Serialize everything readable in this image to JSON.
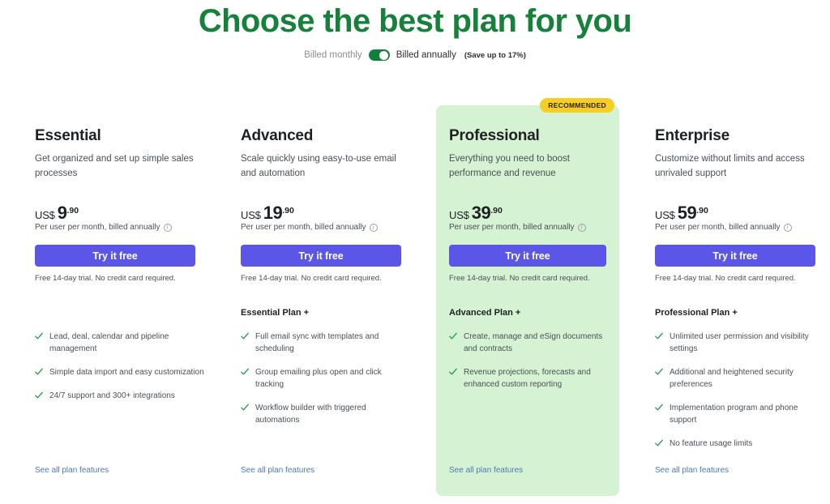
{
  "header": {
    "title": "Choose the best plan for you",
    "title_color": "#17813c",
    "billing": {
      "monthly_label": "Billed monthly",
      "annually_label": "Billed annually",
      "save_note": "(Save up to 17%)",
      "toggle_state": "annually",
      "toggle_on_color": "#12803c"
    }
  },
  "accent": {
    "button": "#5b55e8",
    "featured_bg": "#d5f2d2",
    "badge_bg": "#f6cf21",
    "check": "#1f9d4d",
    "link": "#4d7bb5"
  },
  "common": {
    "price_currency": "US$",
    "price_cents": ".90",
    "price_sub": "Per user per month, billed annually",
    "cta_label": "Try it free",
    "trial_note": "Free 14-day trial. No credit card required.",
    "see_all_label": "See all plan features",
    "info_icon": "info-icon"
  },
  "plans": [
    {
      "name": "Essential",
      "description": "Get organized and set up simple sales processes",
      "price_amount": "9",
      "recommended": false,
      "badge_label": "",
      "includes_header": "",
      "features": [
        "Lead, deal, calendar and pipeline management",
        "Simple data import and easy customization",
        "24/7 support and 300+ integrations"
      ]
    },
    {
      "name": "Advanced",
      "description": "Scale quickly using easy-to-use email and automation",
      "price_amount": "19",
      "recommended": false,
      "badge_label": "",
      "includes_header": "Essential Plan +",
      "features": [
        "Full email sync with templates and scheduling",
        "Group emailing plus open and click tracking",
        "Workflow builder with triggered automations"
      ]
    },
    {
      "name": "Professional",
      "description": "Everything you need to boost performance and revenue",
      "price_amount": "39",
      "recommended": true,
      "badge_label": "RECOMMENDED",
      "includes_header": "Advanced Plan +",
      "features": [
        "Create, manage and eSign documents and contracts",
        "Revenue projections, forecasts and enhanced custom reporting"
      ]
    },
    {
      "name": "Enterprise",
      "description": "Customize without limits and access unrivaled support",
      "price_amount": "59",
      "recommended": false,
      "badge_label": "",
      "includes_header": "Professional Plan +",
      "features": [
        "Unlimited user permission and visibility settings",
        "Additional and heightened security preferences",
        "Implementation program and phone support",
        "No feature usage limits"
      ]
    }
  ]
}
